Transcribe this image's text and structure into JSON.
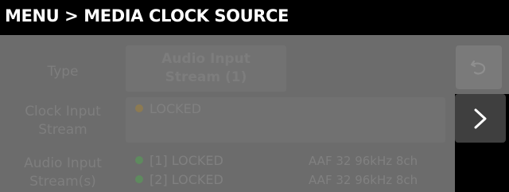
{
  "header": {
    "title": "MENU > MEDIA CLOCK SOURCE"
  },
  "type": {
    "label": "Type",
    "value_line1": "Audio Input",
    "value_line2": "Stream (1)"
  },
  "clock_input": {
    "label_line1": "Clock Input",
    "label_line2": "Stream",
    "status": "LOCKED",
    "dot_color": "#8c7a52"
  },
  "audio_input": {
    "label_line1": "Audio Input",
    "label_line2": "Stream(s)",
    "streams": [
      {
        "status": "[1] LOCKED",
        "format": "AAF 32 96kHz 8ch",
        "dot_color": "#5e8a5e"
      },
      {
        "status": "[2] LOCKED",
        "format": "AAF 32 96kHz 8ch",
        "dot_color": "#5e8a5e"
      }
    ]
  },
  "buttons": {
    "undo_icon": "undo-icon",
    "next_icon": "chevron-right-icon"
  }
}
